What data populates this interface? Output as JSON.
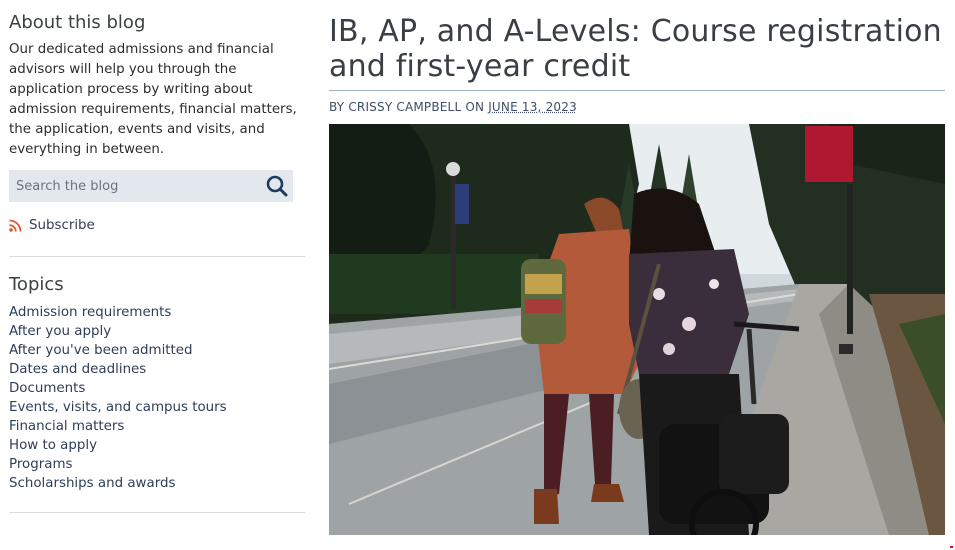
{
  "sidebar": {
    "about_title": "About this blog",
    "about_text": "Our dedicated admissions and financial advisors will help you through the application process by writing about admission requirements, financial matters, the application, events and visits, and everything in between.",
    "search": {
      "placeholder": "Search the blog",
      "icon": "search-icon"
    },
    "subscribe": {
      "label": "Subscribe",
      "icon": "rss-icon",
      "icon_color": "#e0572a"
    },
    "topics_title": "Topics",
    "topics": [
      "Admission requirements",
      "After you apply",
      "After you've been admitted",
      "Dates and deadlines",
      "Documents",
      "Events, visits, and campus tours",
      "Financial matters",
      "How to apply",
      "Programs",
      "Scholarships and awards"
    ]
  },
  "post": {
    "title": "IB, AP, and A-Levels: Course registration and first-year credit",
    "byline_prefix": "BY ",
    "author": "CRISSY CAMPBELL",
    "byline_on": " ON ",
    "date": "JUNE 13, 2023"
  },
  "colors": {
    "accent": "#2d3e58",
    "search_bg": "#e3e8ef",
    "divider": "#d9dde2"
  }
}
